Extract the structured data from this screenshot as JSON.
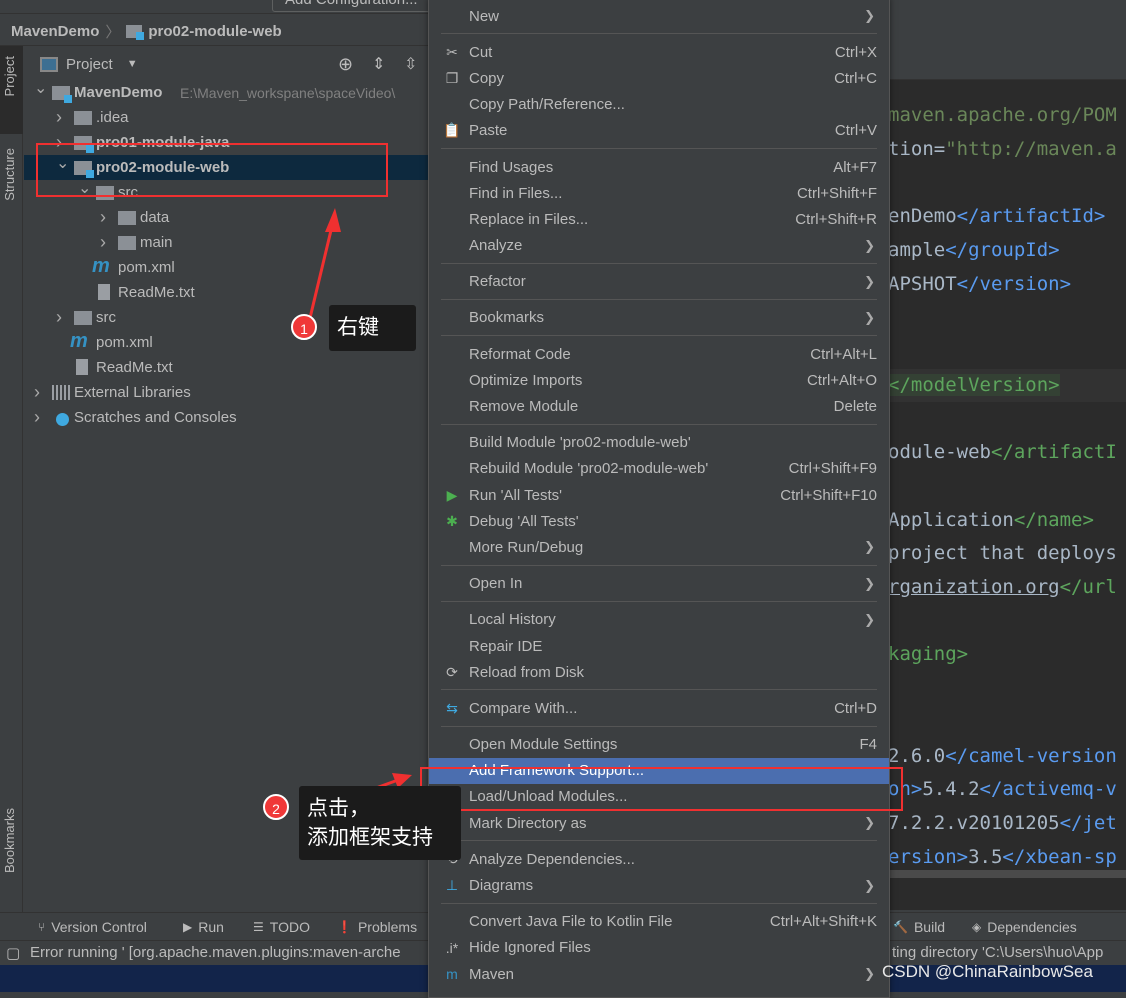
{
  "toolbar": {
    "run_config": "Add Configuration..."
  },
  "breadcrumb": {
    "project": "MavenDemo",
    "module": "pro02-module-web"
  },
  "side_tabs": {
    "project": "Project",
    "structure": "Structure",
    "bookmarks": "Bookmarks"
  },
  "panel": {
    "title": "Project",
    "icons": [
      "locate-icon",
      "expand-all-icon",
      "collapse-all-icon"
    ]
  },
  "tree": [
    {
      "label": "MavenDemo",
      "path": "E:\\Maven_workspane\\spaceVideo\\",
      "level": 0,
      "type": "module",
      "expanded": true,
      "bold": true
    },
    {
      "label": ".idea",
      "level": 1,
      "type": "folder",
      "expanded": false
    },
    {
      "label": "pro01-module-java",
      "level": 1,
      "type": "module",
      "expanded": false,
      "bold": true
    },
    {
      "label": "pro02-module-web",
      "level": 1,
      "type": "module",
      "expanded": true,
      "bold": true,
      "selected": true
    },
    {
      "label": "src",
      "level": 2,
      "type": "folder",
      "expanded": true
    },
    {
      "label": "data",
      "level": 3,
      "type": "folder",
      "expanded": false
    },
    {
      "label": "main",
      "level": 3,
      "type": "folder",
      "expanded": false
    },
    {
      "label": "pom.xml",
      "level": 2,
      "type": "maven"
    },
    {
      "label": "ReadMe.txt",
      "level": 2,
      "type": "text"
    },
    {
      "label": "src",
      "level": 1,
      "type": "folder",
      "expanded": false
    },
    {
      "label": "pom.xml",
      "level": 1,
      "type": "maven"
    },
    {
      "label": "ReadMe.txt",
      "level": 1,
      "type": "text"
    },
    {
      "label": "External Libraries",
      "level": 0,
      "type": "libraries",
      "expanded": false
    },
    {
      "label": "Scratches and Consoles",
      "level": 0,
      "type": "scratches",
      "expanded": false
    }
  ],
  "editor": {
    "lines": [
      [
        {
          "t": "maven.apache.org/POM",
          "c": "str"
        }
      ],
      [
        {
          "t": "tion=",
          "c": "text"
        },
        {
          "t": "\"http://maven.a",
          "c": "str"
        }
      ],
      [],
      [
        {
          "t": "enDemo",
          "c": "text"
        },
        {
          "t": "</artifactId>",
          "c": "blue"
        }
      ],
      [
        {
          "t": "ample",
          "c": "text"
        },
        {
          "t": "</groupId>",
          "c": "blue"
        }
      ],
      [
        {
          "t": "APSHOT",
          "c": "text"
        },
        {
          "t": "</version>",
          "c": "blue"
        }
      ],
      [],
      [],
      [
        {
          "t": "</modelVersion>",
          "c": "green",
          "hl": true
        }
      ],
      [],
      [
        {
          "t": "odule-web",
          "c": "text"
        },
        {
          "t": "</artifactI",
          "c": "green"
        }
      ],
      [],
      [
        {
          "t": "Application",
          "c": "text"
        },
        {
          "t": "</name>",
          "c": "green"
        }
      ],
      [
        {
          "t": "project that deploys",
          "c": "text"
        }
      ],
      [
        {
          "t": "rganization.org",
          "c": "text",
          "ul": true
        },
        {
          "t": "</url",
          "c": "green"
        }
      ],
      [],
      [
        {
          "t": "kaging>",
          "c": "green"
        }
      ],
      [],
      [],
      [
        {
          "t": "2.6.0",
          "c": "text"
        },
        {
          "t": "</camel-version",
          "c": "blue"
        }
      ],
      [
        {
          "t": "on>",
          "c": "blue"
        },
        {
          "t": "5.4.2",
          "c": "text"
        },
        {
          "t": "</activemq-v",
          "c": "blue"
        }
      ],
      [
        {
          "t": "7.2.2.v20101205",
          "c": "text"
        },
        {
          "t": "</jet",
          "c": "blue"
        }
      ],
      [
        {
          "t": "ersion>",
          "c": "blue"
        },
        {
          "t": "3.5",
          "c": "text"
        },
        {
          "t": "</xbean-sp",
          "c": "blue"
        }
      ]
    ]
  },
  "context_menu": [
    {
      "label": "New",
      "submenu": true
    },
    {
      "sep": true
    },
    {
      "label": "Cut",
      "shortcut": "Ctrl+X",
      "icon": "scissors-icon"
    },
    {
      "label": "Copy",
      "shortcut": "Ctrl+C",
      "icon": "copy-icon"
    },
    {
      "label": "Copy Path/Reference..."
    },
    {
      "label": "Paste",
      "shortcut": "Ctrl+V",
      "icon": "clipboard-icon"
    },
    {
      "sep": true
    },
    {
      "label": "Find Usages",
      "shortcut": "Alt+F7"
    },
    {
      "label": "Find in Files...",
      "shortcut": "Ctrl+Shift+F"
    },
    {
      "label": "Replace in Files...",
      "shortcut": "Ctrl+Shift+R"
    },
    {
      "label": "Analyze",
      "submenu": true
    },
    {
      "sep": true
    },
    {
      "label": "Refactor",
      "submenu": true
    },
    {
      "sep": true
    },
    {
      "label": "Bookmarks",
      "submenu": true
    },
    {
      "sep": true
    },
    {
      "label": "Reformat Code",
      "shortcut": "Ctrl+Alt+L"
    },
    {
      "label": "Optimize Imports",
      "shortcut": "Ctrl+Alt+O"
    },
    {
      "label": "Remove Module",
      "shortcut": "Delete"
    },
    {
      "sep": true
    },
    {
      "label": "Build Module 'pro02-module-web'"
    },
    {
      "label": "Rebuild Module 'pro02-module-web'",
      "shortcut": "Ctrl+Shift+F9"
    },
    {
      "label": "Run 'All Tests'",
      "shortcut": "Ctrl+Shift+F10",
      "icon": "run-icon"
    },
    {
      "label": "Debug 'All Tests'",
      "icon": "debug-icon"
    },
    {
      "label": "More Run/Debug",
      "submenu": true
    },
    {
      "sep": true
    },
    {
      "label": "Open In",
      "submenu": true
    },
    {
      "sep": true
    },
    {
      "label": "Local History",
      "submenu": true
    },
    {
      "label": "Repair IDE"
    },
    {
      "label": "Reload from Disk",
      "icon": "reload-icon"
    },
    {
      "sep": true
    },
    {
      "label": "Compare With...",
      "shortcut": "Ctrl+D",
      "icon": "compare-icon"
    },
    {
      "sep": true
    },
    {
      "label": "Open Module Settings",
      "shortcut": "F4"
    },
    {
      "label": "Add Framework Support...",
      "active": true
    },
    {
      "label": "Load/Unload Modules..."
    },
    {
      "label": "Mark Directory as",
      "submenu": true
    },
    {
      "sep": true
    },
    {
      "label": "Analyze Dependencies...",
      "icon": "analyze-dependencies-icon"
    },
    {
      "label": "Diagrams",
      "submenu": true,
      "icon": "diagram-icon"
    },
    {
      "sep": true
    },
    {
      "label": "Convert Java File to Kotlin File",
      "shortcut": "Ctrl+Alt+Shift+K"
    },
    {
      "label": "Hide Ignored Files",
      "icon": "ignored-files-icon"
    },
    {
      "label": "Maven",
      "submenu": true,
      "icon": "maven-icon"
    }
  ],
  "bottom_tools": [
    {
      "label": "Version Control",
      "icon": "version-control-icon"
    },
    {
      "label": "Run",
      "icon": "run-icon"
    },
    {
      "label": "TODO",
      "icon": "todo-icon"
    },
    {
      "label": "Problems",
      "icon": "problems-icon"
    },
    {
      "label": "Build",
      "icon": "build-icon"
    },
    {
      "label": "Dependencies",
      "icon": "dependencies-icon"
    }
  ],
  "status": {
    "left": "Error running ' [org.apache.maven.plugins:maven-arche",
    "right": "ting directory 'C:\\Users\\huo\\App"
  },
  "annotations": {
    "step1_number": "1",
    "step1_text": "右键",
    "step2_number": "2",
    "step2_line1": "点击，",
    "step2_line2": "添加框架支持"
  },
  "watermark": "CSDN @ChinaRainbowSea",
  "colors": {
    "selection": "#0d293e",
    "menu_highlight": "#4b6eaf",
    "annotation_red": "#f03030",
    "background": "#3c3f41",
    "editor_bg": "#2b2b2b"
  }
}
